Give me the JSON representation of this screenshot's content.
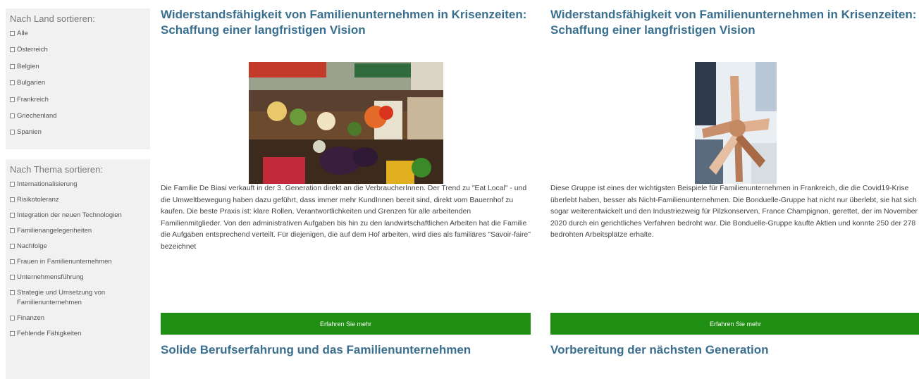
{
  "sidebar": {
    "land": {
      "title": "Nach Land sortieren:",
      "items": [
        "Alle",
        "Österreich",
        "Belgien",
        "Bulgarien",
        "Frankreich",
        "Griechenland",
        "Spanien"
      ]
    },
    "thema": {
      "title": "Nach Thema sortieren:",
      "items": [
        "Internationalisierung",
        "Risikotoleranz",
        "Integration der neuen Technologien",
        "Familienangelegenheiten",
        "Nachfolge",
        "Frauen in Familienunternehmen",
        "Unternehmensführung",
        "Strategie und Umsetzung von Familienunternehmen",
        "Finanzen",
        "Fehlende Fähigkeiten"
      ]
    }
  },
  "cards": [
    {
      "title": "Widerstandsfähigkeit von Familienunternehmen in Krisenzeiten: Schaffung einer langfristigen Vision",
      "text": "Die Familie De Biasi verkauft in der 3. Generation direkt an die VerbraucherInnen. Der Trend zu \"Eat Local\" - und die Umweltbewegung haben dazu geführt, dass immer mehr KundInnen bereit sind, direkt vom Bauernhof zu kaufen. Die beste Praxis ist: klare Rollen, Verantwortlichkeiten und Grenzen für alle arbeitenden Familienmitglieder. Von den administrativen Aufgaben bis hin zu den landwirtschaftlichen Arbeiten hat die Familie die Aufgaben entsprechend verteilt. Für diejenigen, die auf dem Hof arbeiten, wird dies als familiäres \"Savoir-faire\" bezeichnet",
      "button": "Erfahren Sie mehr",
      "next_title": "Solide Berufserfahrung und das Familienunternehmen",
      "image": "market-vegetables-photo"
    },
    {
      "title": "Widerstandsfähigkeit von Familienunternehmen in Krisenzeiten: Schaffung einer langfristigen Vision",
      "text": "Diese Gruppe ist eines der wichtigsten Beispiele für Familienunternehmen in Frankreich, die die Covid19-Krise überlebt haben, besser als Nicht-Familienunternehmen. Die Bonduelle-Gruppe hat nicht nur überlebt, sie hat sich sogar weiterentwickelt und den Industriezweig für Pilzkonserven, France Champignon, gerettet, der im November 2020 durch ein gerichtliches Verfahren bedroht war. Die Bonduelle-Gruppe kaufte Aktien und konnte 250 der 278 bedrohten Arbeitsplätze erhalte.",
      "button": "Erfahren Sie mehr",
      "next_title": "Vorbereitung der nächsten Generation",
      "image": "team-hands-photo"
    }
  ],
  "colors": {
    "accent": "#1e8f12",
    "title": "#3a6f8f",
    "panel": "#f1f1f1"
  }
}
